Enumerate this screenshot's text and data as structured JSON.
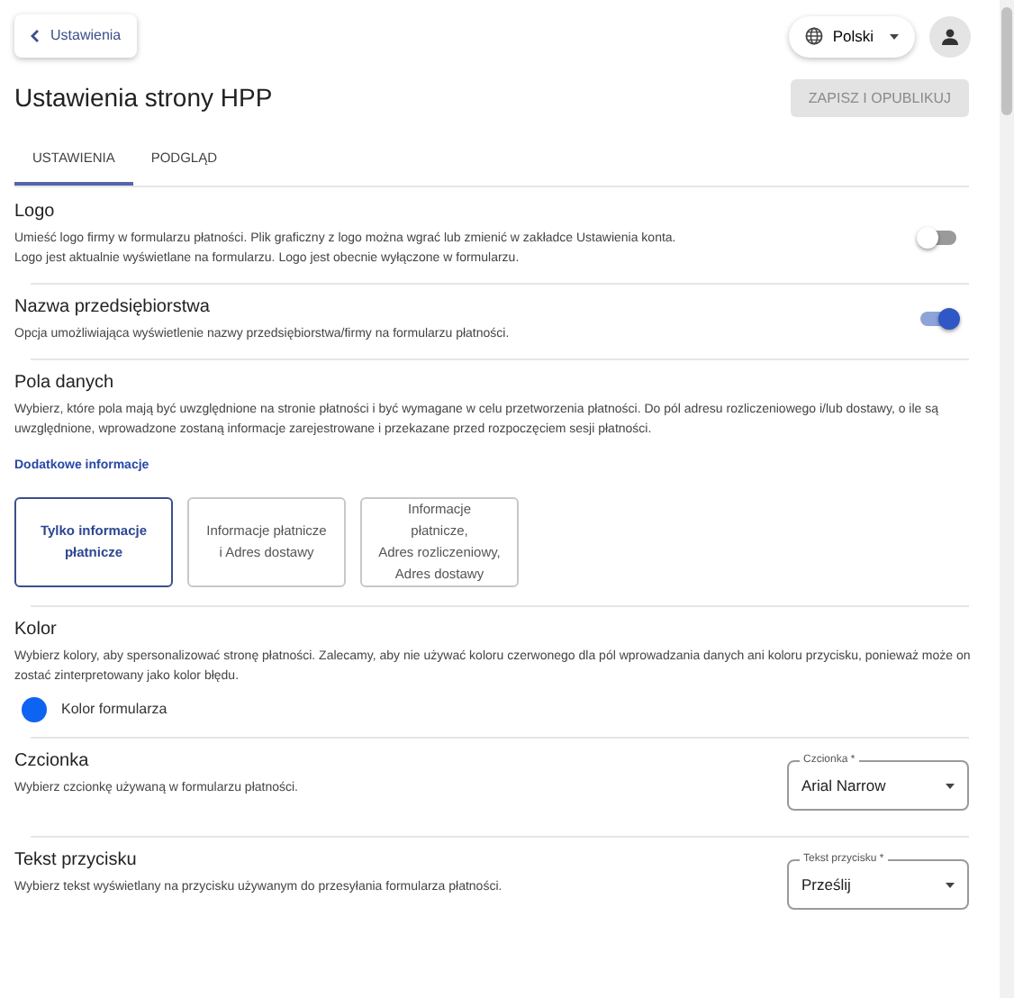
{
  "back_button": {
    "label": "Ustawienia"
  },
  "language": {
    "label": "Polski"
  },
  "title": "Ustawienia strony HPP",
  "publish_button": {
    "label": "ZAPISZ I OPUBLIKUJ",
    "disabled": true
  },
  "tabs": [
    {
      "label": "USTAWIENIA",
      "selected": true
    },
    {
      "label": "PODGLĄD",
      "selected": false
    }
  ],
  "sections": [
    {
      "kind": "toggle",
      "title": "Logo",
      "description": "Umieść logo firmy w formularzu płatności. Plik graficzny z logo można wgrać lub zmienić w zakładce Ustawienia konta. Logo jest aktualnie wyświetlane na formularzu. Logo jest obecnie wyłączone w formularzu.",
      "on": false
    },
    {
      "kind": "toggle",
      "title": "Nazwa przedsiębiorstwa",
      "description": "Opcja umożliwiająca wyświetlenie nazwy przedsiębiorstwa/firmy na formularzu płatności.",
      "on": true
    },
    {
      "kind": "options",
      "title": "Pola danych",
      "description": "Wybierz, które pola mają być uwzględnione na stronie płatności i być wymagane w celu przetworzenia płatności. Do pól adresu rozliczeniowego i/lub dostawy, o ile są uwzględnione, wprowadzone zostaną informacje zarejestrowane i przekazane przed rozpoczęciem sesji płatności.",
      "link": "Dodatkowe informacje",
      "options": [
        {
          "lines": [
            "Tylko informacje",
            "płatnicze"
          ],
          "selected": true
        },
        {
          "lines": [
            "Informacje płatnicze",
            "i Adres dostawy"
          ],
          "selected": false
        },
        {
          "lines": [
            "Informacje",
            "płatnicze,",
            "Adres rozliczeniowy,",
            "Adres dostawy"
          ],
          "selected": false
        }
      ]
    },
    {
      "kind": "color",
      "title": "Kolor",
      "description": "Wybierz kolory, aby spersonalizować stronę płatności. Zalecamy, aby nie używać koloru czerwonego dla pól wprowadzania danych ani koloru przycisku, ponieważ może on zostać zinterpretowany jako kolor błędu.",
      "swatch": {
        "label": "Kolor formularza",
        "color": "#0d63f2"
      }
    },
    {
      "kind": "select",
      "title": "Czcionka",
      "description": "Wybierz czcionkę używaną w formularzu płatności.",
      "field_label": "Czcionka *",
      "value": "Arial Narrow"
    },
    {
      "kind": "select",
      "title": "Tekst przycisku",
      "description": "Wybierz tekst wyświetlany na przycisku używanym do przesyłania formularza płatności.",
      "field_label": "Tekst przycisku *",
      "value": "Prześlij"
    }
  ]
}
